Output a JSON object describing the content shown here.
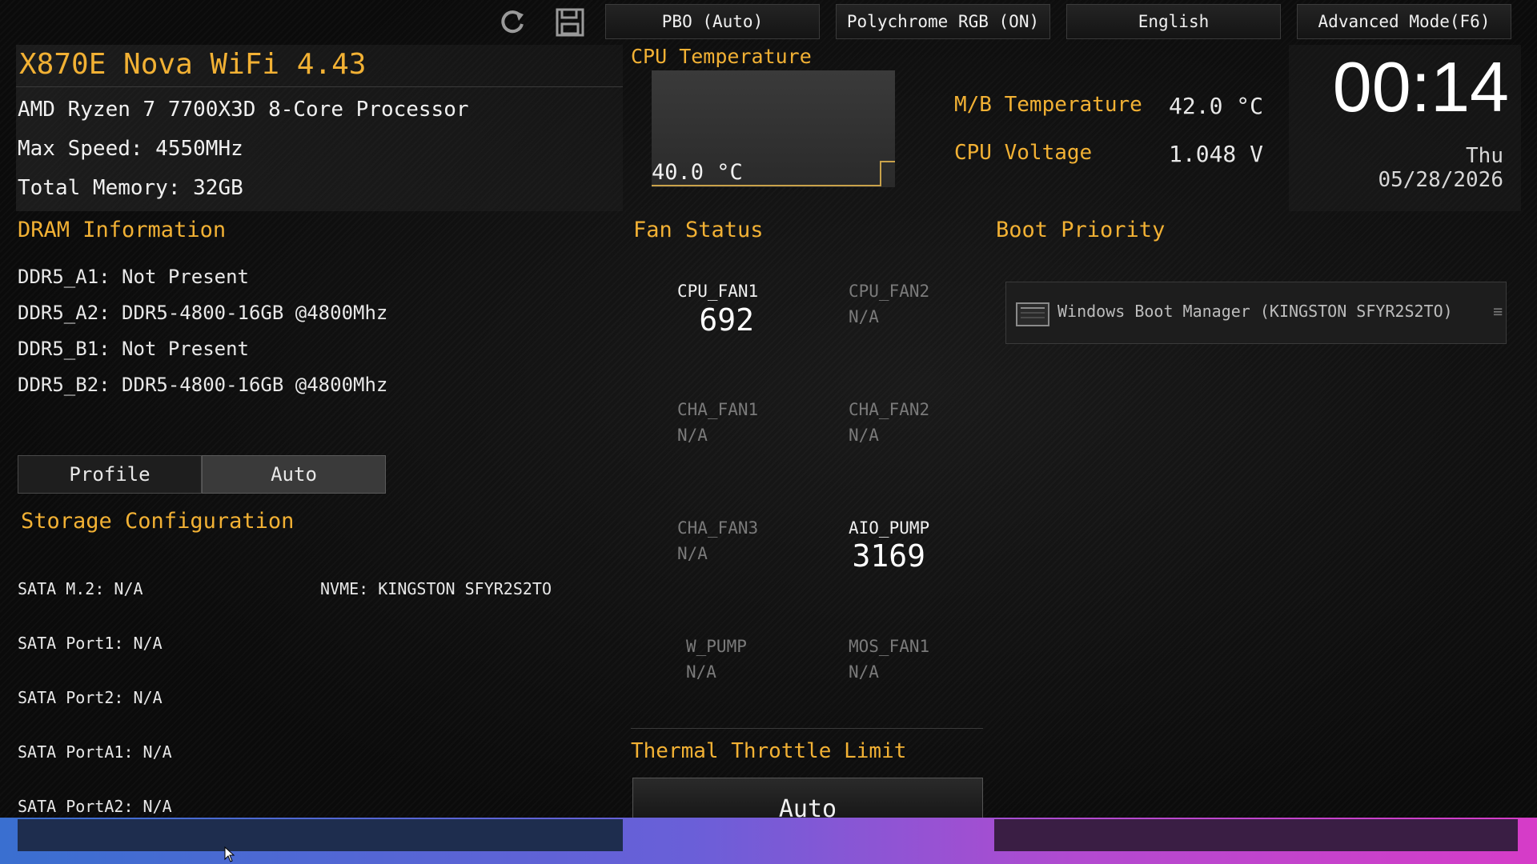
{
  "toolbar": {
    "pbo_label": "PBO (Auto)",
    "rgb_label": "Polychrome RGB (ON)",
    "language_label": "English",
    "advanced_label": "Advanced Mode(F6)",
    "refresh_icon": "refresh-icon",
    "save_icon": "floppy-disk-icon"
  },
  "system": {
    "title": "X870E Nova WiFi 4.43",
    "cpu": "AMD Ryzen 7 7700X3D 8-Core Processor",
    "max_speed": "Max Speed: 4550MHz",
    "memory": "Total Memory: 32GB"
  },
  "cpu_temp": {
    "title": "CPU Temperature",
    "value": "40.0 °C"
  },
  "sensors": {
    "mb_temp_label": "M/B Temperature",
    "mb_temp_value": "42.0 °C",
    "cpu_voltage_label": "CPU Voltage",
    "cpu_voltage_value": "1.048 V"
  },
  "clock": {
    "time": "00:14",
    "date": "Thu 05/28/2026"
  },
  "dram": {
    "title": "DRAM Information",
    "slots": [
      "DDR5_A1: Not Present",
      "DDR5_A2: DDR5-4800-16GB @4800Mhz",
      "DDR5_B1: Not Present",
      "DDR5_B2: DDR5-4800-16GB @4800Mhz"
    ],
    "profile_label": "Profile",
    "profile_value": "Auto"
  },
  "storage": {
    "title": "Storage Configuration",
    "sata_m2": "SATA M.2: N/A",
    "nvme": "NVME: KINGSTON SFYR2S2TO",
    "port1": "SATA Port1: N/A",
    "port2": "SATA Port2: N/A",
    "porta1": "SATA PortA1: N/A",
    "porta2": "SATA PortA2: N/A"
  },
  "fans": {
    "title": "Fan Status",
    "cpu_fan1": {
      "name": "CPU_FAN1",
      "value": "692"
    },
    "cpu_fan2": {
      "name": "CPU_FAN2",
      "value": "N/A"
    },
    "cha_fan1": {
      "name": "CHA_FAN1",
      "value": "N/A"
    },
    "cha_fan2": {
      "name": "CHA_FAN2",
      "value": "N/A"
    },
    "cha_fan3": {
      "name": "CHA_FAN3",
      "value": "N/A"
    },
    "aio_pump": {
      "name": "AIO_PUMP",
      "value": "3169"
    },
    "w_pump": {
      "name": "W_PUMP",
      "value": "N/A"
    },
    "mos_fan1": {
      "name": "MOS_FAN1",
      "value": "N/A"
    }
  },
  "thermal": {
    "title": "Thermal Throttle Limit",
    "value": "Auto"
  },
  "boot": {
    "title": "Boot Priority",
    "item": "Windows Boot Manager (KINGSTON SFYR2S2TO)"
  },
  "colors": {
    "accent": "#f2b134",
    "bottom_left": "#3a6fd0",
    "bottom_right": "#d63cc8"
  }
}
